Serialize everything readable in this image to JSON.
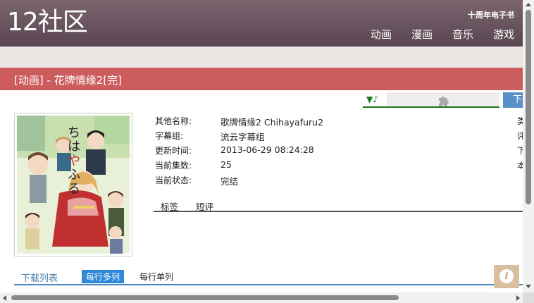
{
  "header": {
    "logo": "12社区",
    "top_link": "十周年电子书",
    "nav": [
      "动画",
      "漫画",
      "音乐",
      "游戏"
    ]
  },
  "page_title": "[动画] - 花牌情缘2[完]",
  "toolbar": {
    "music_icon": "music-note-icon",
    "plugin_icon": "puzzle-piece-icon",
    "download_label": "下"
  },
  "info": {
    "rows": [
      {
        "label": "其他名称:",
        "value": "歌牌情缘2 Chihayafuru2"
      },
      {
        "label": "字幕组:",
        "value": "流云字幕组"
      },
      {
        "label": "更新时间:",
        "value": "2013-06-29 08:24:28"
      },
      {
        "label": "当前集数:",
        "value": "25"
      },
      {
        "label": "当前状态:",
        "value": "完结"
      }
    ],
    "edge_labels": [
      "类",
      "评",
      "下",
      "本"
    ]
  },
  "subtabs": [
    "标签",
    "短评"
  ],
  "download": {
    "title": "下载列表",
    "mode_active": "每行多列",
    "mode_other": "每行单列"
  },
  "colors": {
    "header_bg": "#6b5560",
    "title_bar": "#cd5c5c",
    "accent_blue": "#2f88d8",
    "music_green": "#1a7a1a"
  }
}
